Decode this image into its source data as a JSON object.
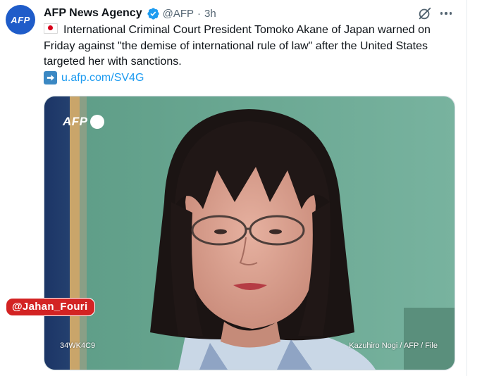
{
  "tweet": {
    "avatar_text": "AFP",
    "display_name": "AFP News Agency",
    "handle": "@AFP",
    "separator": "·",
    "time": "3h",
    "text": "International Criminal Court President Tomoko Akane of Japan warned on Friday against \"the demise of international rule of law\" after the United States targeted her with sanctions.",
    "link": "u.afp.com/SV4G",
    "icons": {
      "verified": "verified-badge-icon",
      "grok": "grok-icon",
      "more": "more-options-icon",
      "flag": "japan-flag-icon",
      "arrow": "right-arrow-icon"
    }
  },
  "media": {
    "logo_text": "AFP",
    "image_code": "34WK4C9",
    "credit": "Kazuhiro Nogi / AFP / File"
  },
  "watermark": "@Jahan_Fouri",
  "colors": {
    "link": "#1d9bf0",
    "verified": "#1d9bf0",
    "avatar": "#1f5cc9",
    "watermark": "#d32323"
  }
}
